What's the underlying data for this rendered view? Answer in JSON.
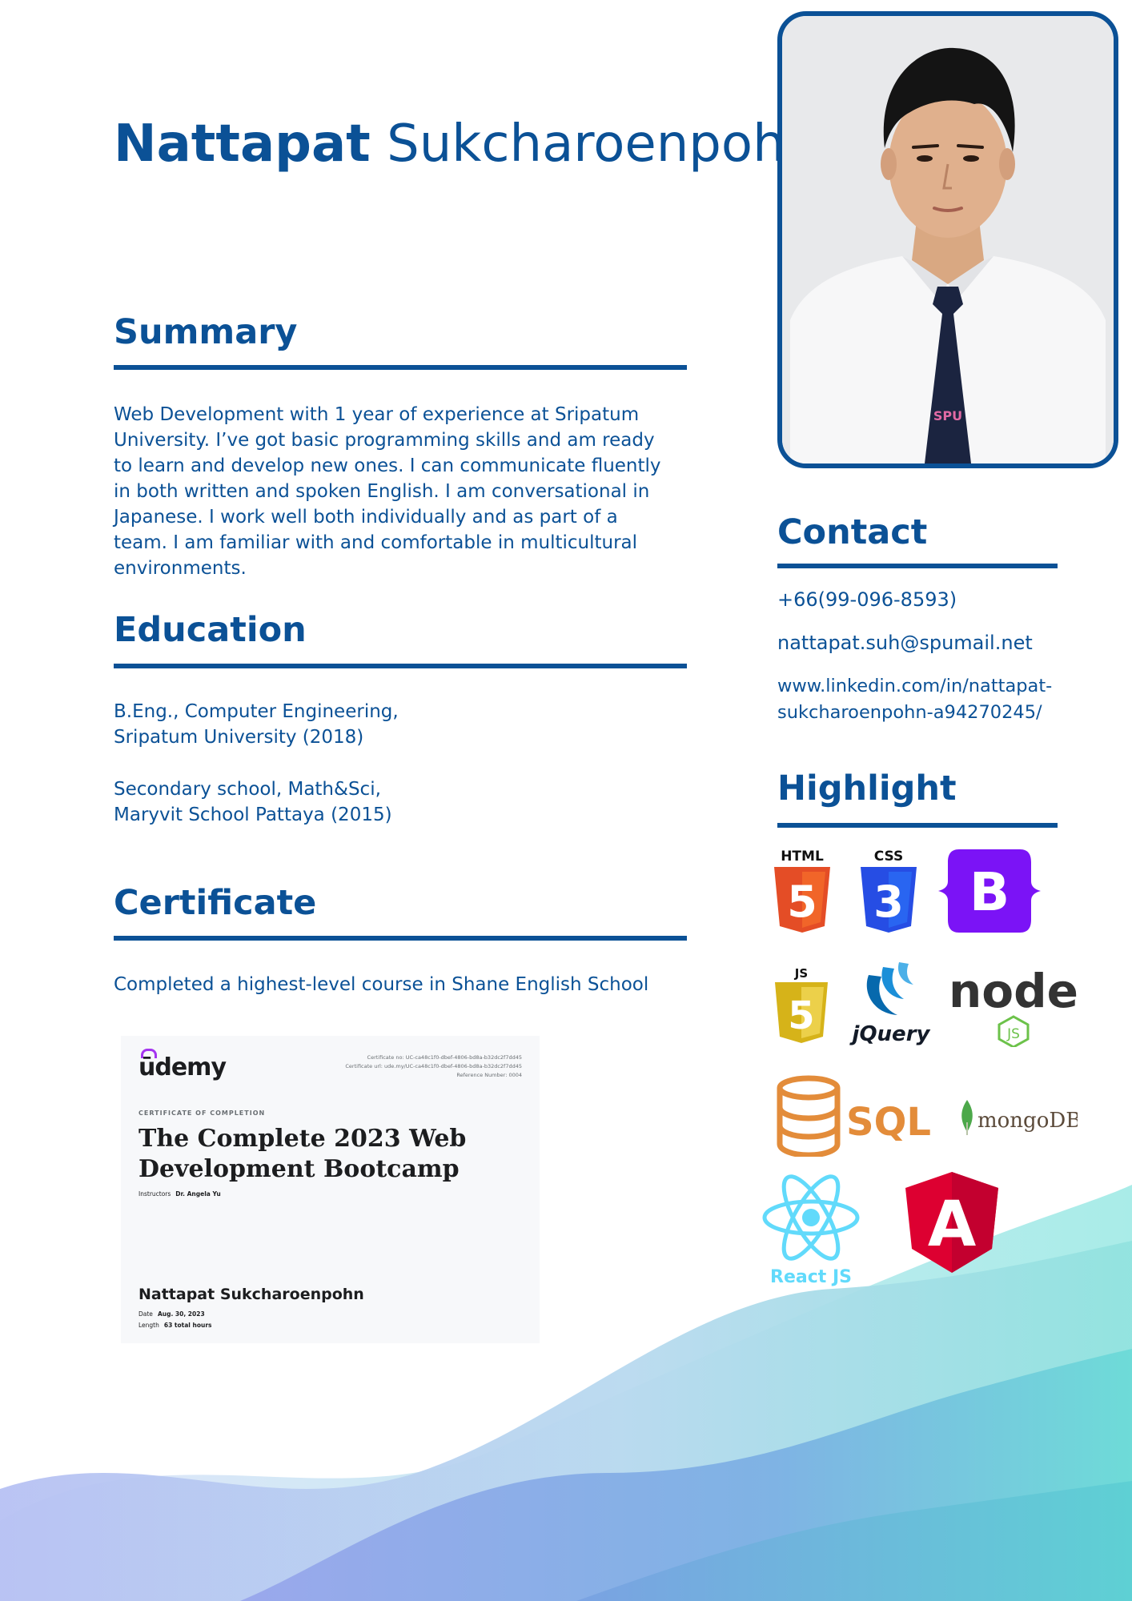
{
  "header": {
    "first_name": "Nattapat",
    "last_name": "Sukcharoenpohn"
  },
  "summary": {
    "heading": "Summary",
    "lines": [
      "Web Development with 1 year of experience at Sripatum",
      "University. I’ve got basic programming skills and am ready",
      "to learn and develop new ones. I can communicate fluently",
      "in both written and spoken English. I am conversational in",
      "Japanese. I work well both individually and as part of a",
      "team. I am familiar with and comfortable in multicultural",
      "environments."
    ]
  },
  "education": {
    "heading": "Education",
    "entries": [
      {
        "line1": "B.Eng., Computer Engineering,",
        "line2": "Sripatum University (2018)"
      },
      {
        "line1": "Secondary school, Math&Sci,",
        "line2": "Maryvit School Pattaya (2015)"
      }
    ]
  },
  "certificate": {
    "heading": "Certificate",
    "description": "Completed a highest-level course in Shane English School",
    "card": {
      "brand": "ūdemy",
      "ref_lines": [
        "Certificate no: UC-ca48c1f0-dbef-4806-bd8a-b32dc2f7dd45",
        "Certificate url: ude.my/UC-ca48c1f0-dbef-4806-bd8a-b32dc2f7dd45",
        "Reference Number: 0004"
      ],
      "kicker": "CERTIFICATE OF COMPLETION",
      "title_line1": "The Complete 2023 Web",
      "title_line2": "Development Bootcamp",
      "instructors_label": "Instructors",
      "instructor": "Dr. Angela Yu",
      "student": "Nattapat Sukcharoenpohn",
      "date_label": "Date",
      "date": "Aug. 30, 2023",
      "length_label": "Length",
      "length": "63 total hours"
    }
  },
  "contact": {
    "heading": "Contact",
    "phone": "+66(99-096-8593)",
    "email": "nattapat.suh@spumail.net",
    "linkedin_line1": "www.linkedin.com/in/nattapat-",
    "linkedin_line2": "sukcharoenpohn-a94270245/"
  },
  "highlight": {
    "heading": "Highlight",
    "logos": {
      "html_label": "HTML",
      "html_glyph": "5",
      "css_label": "CSS",
      "css_glyph": "3",
      "bootstrap_glyph": "B",
      "js_label": "JS",
      "js_glyph": "5",
      "jquery_label": "jQuery",
      "node_text": "node",
      "node_js": "JS",
      "sql_label": "SQL",
      "mongodb_label": "mongoDB",
      "react_label": "React JS",
      "angular_glyph": "A"
    }
  },
  "colors": {
    "primary": "#0b5196",
    "html": "#e44d26",
    "css": "#264de4",
    "bootstrap": "#7b13f6",
    "js": "#e8c32e",
    "jquery": "#0769ad",
    "node": "#333333",
    "node_green": "#6cc24a",
    "sql": "#e38c3a",
    "mongodb": "#4ca84a",
    "react": "#61dafb",
    "angular": "#dd0031",
    "wave_violet": "#aab4f0",
    "wave_teal": "#6fded8"
  }
}
